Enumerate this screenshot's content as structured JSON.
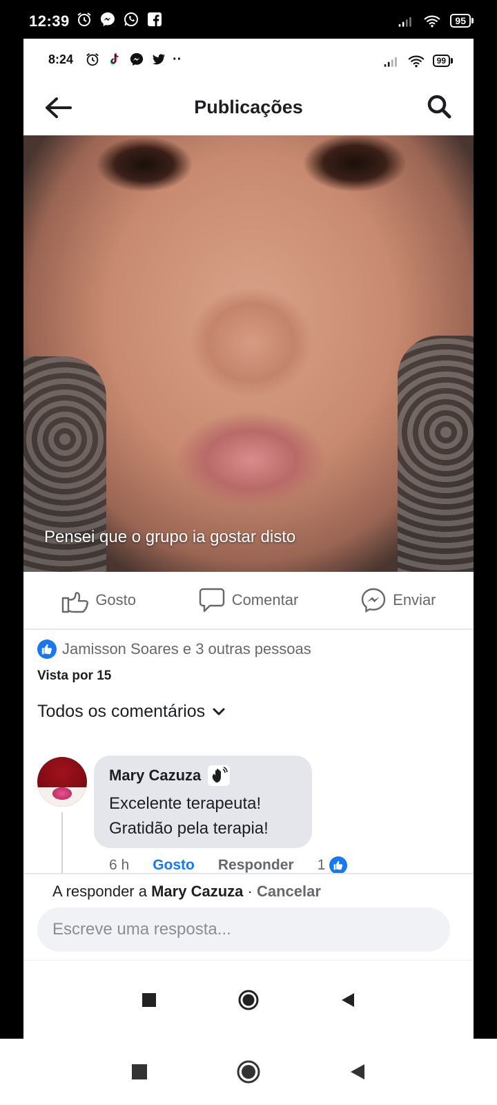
{
  "outer_status": {
    "time": "12:39",
    "battery": "95"
  },
  "inner_status": {
    "time": "8:24",
    "battery": "99",
    "more": "··"
  },
  "header": {
    "title": "Publicações"
  },
  "post": {
    "caption": "Pensei que o grupo ia gostar disto"
  },
  "actions": {
    "like": "Gosto",
    "comment": "Comentar",
    "send": "Enviar"
  },
  "reactions": {
    "text": "Jamisson Soares e 3 outras pessoas",
    "seen": "Vista por 15"
  },
  "comments_filter": {
    "label": "Todos os comentários"
  },
  "comment": {
    "author": "Mary Cazuza",
    "line1": "Excelente terapeuta!",
    "line2": "Gratidão pela terapia!",
    "age": "6 h",
    "like": "Gosto",
    "reply": "Responder",
    "like_count": "1"
  },
  "reply_bar": {
    "prefix": "A responder a",
    "target": "Mary Cazuza",
    "separator": " · ",
    "cancel": "Cancelar",
    "placeholder": "Escreve uma resposta..."
  },
  "colors": {
    "accent": "#1877f2",
    "text": "#1c1e21",
    "muted": "#65676b",
    "bubble": "#e4e6eb"
  }
}
